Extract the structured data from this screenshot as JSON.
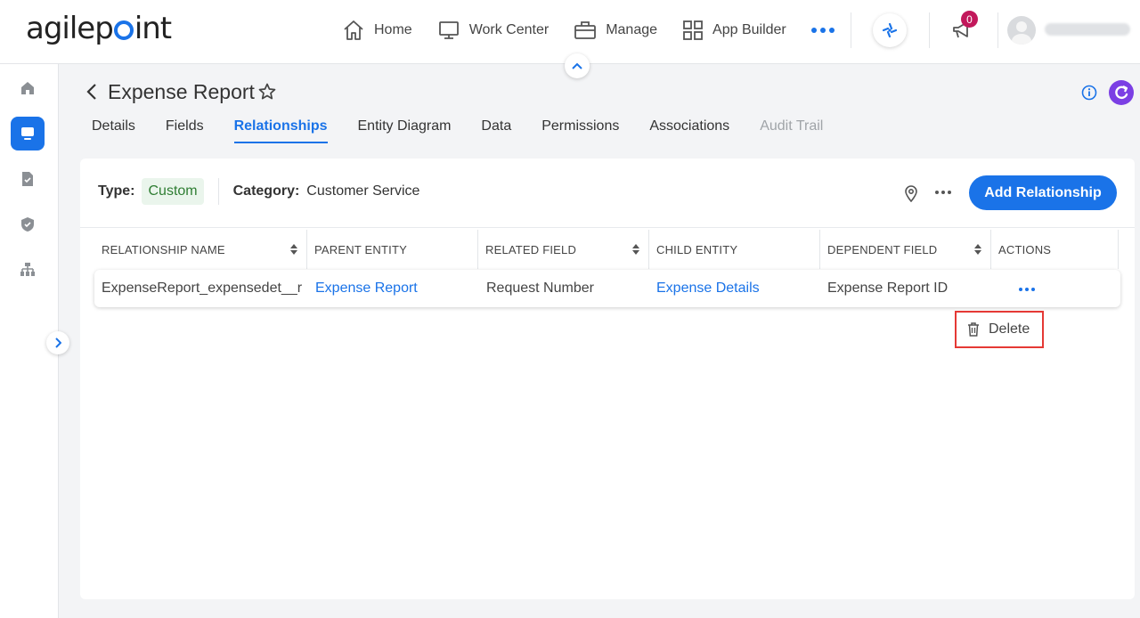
{
  "brand": {
    "logo_text_a": "agilep",
    "logo_text_b": "int"
  },
  "nav": {
    "items": [
      {
        "label": "Home",
        "icon": "home-icon"
      },
      {
        "label": "Work Center",
        "icon": "monitor-icon"
      },
      {
        "label": "Manage",
        "icon": "briefcase-icon"
      },
      {
        "label": "App Builder",
        "icon": "grid-icon"
      }
    ],
    "notifications_count": "0"
  },
  "page": {
    "title": "Expense Report",
    "tabs": [
      {
        "label": "Details",
        "state": "normal"
      },
      {
        "label": "Fields",
        "state": "normal"
      },
      {
        "label": "Relationships",
        "state": "active"
      },
      {
        "label": "Entity Diagram",
        "state": "normal"
      },
      {
        "label": "Data",
        "state": "normal"
      },
      {
        "label": "Permissions",
        "state": "normal"
      },
      {
        "label": "Associations",
        "state": "normal"
      },
      {
        "label": "Audit Trail",
        "state": "disabled"
      }
    ]
  },
  "meta": {
    "type_label": "Type:",
    "type_value": "Custom",
    "category_label": "Category:",
    "category_value": "Customer Service",
    "add_button": "Add Relationship"
  },
  "table": {
    "columns": [
      {
        "label": "RELATIONSHIP NAME",
        "sortable": true
      },
      {
        "label": "PARENT ENTITY",
        "sortable": false
      },
      {
        "label": "RELATED FIELD",
        "sortable": true
      },
      {
        "label": "CHILD ENTITY",
        "sortable": false
      },
      {
        "label": "DEPENDENT FIELD",
        "sortable": true
      },
      {
        "label": "ACTIONS",
        "sortable": false
      }
    ],
    "rows": [
      {
        "relationship_name": "ExpenseReport_expensedet__r",
        "parent_entity": "Expense Report",
        "related_field": "Request Number",
        "child_entity": "Expense Details",
        "dependent_field": "Expense Report ID"
      }
    ]
  },
  "context_menu": {
    "delete_label": "Delete"
  },
  "colors": {
    "accent": "#1a73e8",
    "type_green": "#2e7d32",
    "highlight_red": "#e53935",
    "badge": "#c2185b",
    "refresh_purple": "#7b3fe4"
  }
}
